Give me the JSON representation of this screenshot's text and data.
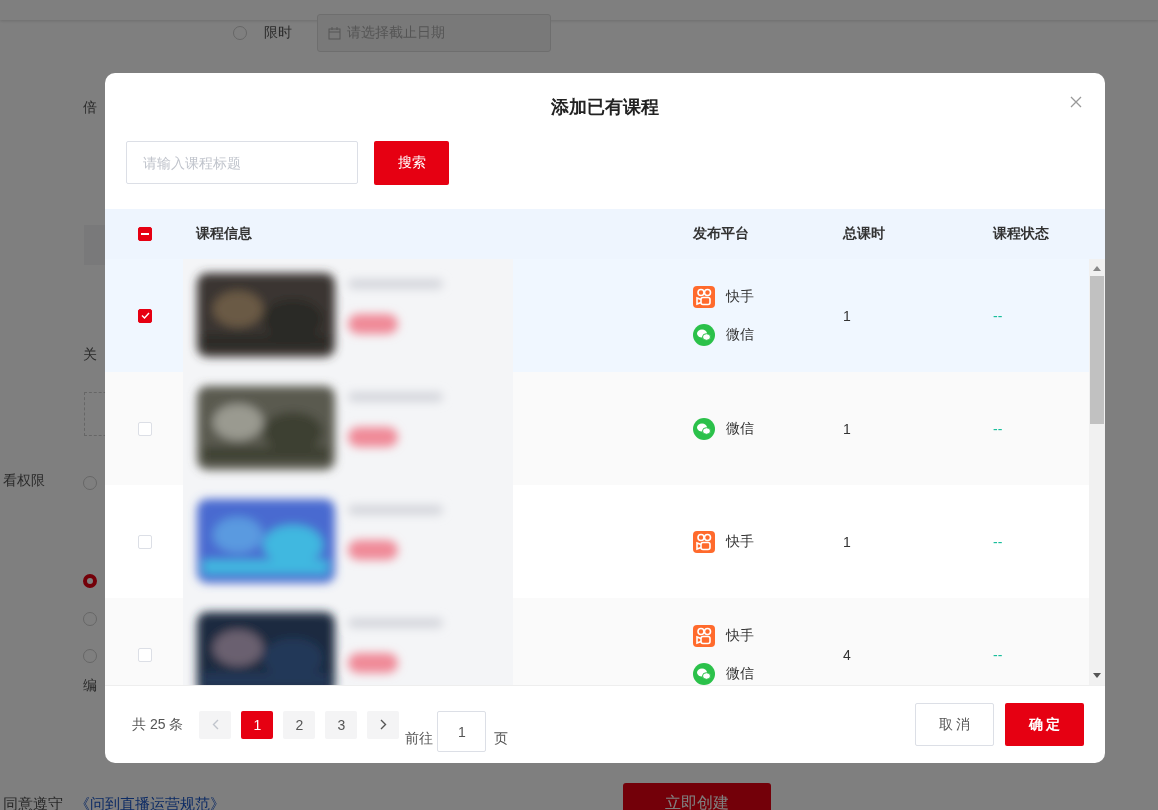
{
  "background": {
    "expiry_radio": {
      "label": "限时",
      "selected": false
    },
    "date_field": {
      "placeholder": "请选择截止日期"
    },
    "labels": [
      "倍",
      "关",
      "看权限"
    ],
    "radios": [
      {
        "selected": false
      },
      {
        "selected": true
      },
      {
        "selected": false
      },
      {
        "selected": false
      }
    ],
    "edit_label": "编",
    "agreement_text": "同意遵守",
    "agreement_link": "《问到直播运营规范》",
    "create_button": "立即创建"
  },
  "dialog": {
    "title": "添加已有课程",
    "search": {
      "placeholder": "请输入课程标题",
      "button": "搜索"
    },
    "table": {
      "select_all": {
        "indeterminate": true
      },
      "columns": [
        "课程信息",
        "发布平台",
        "总课时",
        "课程状态"
      ],
      "rows": [
        {
          "checked": true,
          "course": {
            "kind": "picture"
          },
          "platforms": [
            {
              "kind": "kuaishou",
              "name": "快手"
            },
            {
              "kind": "wechat",
              "name": "微信"
            }
          ],
          "hours": "1",
          "status": "--"
        },
        {
          "checked": false,
          "course": {
            "kind": "picture"
          },
          "platforms": [
            {
              "kind": "wechat",
              "name": "微信"
            }
          ],
          "hours": "1",
          "status": "--"
        },
        {
          "checked": false,
          "course": {
            "kind": "picture"
          },
          "platforms": [
            {
              "kind": "kuaishou",
              "name": "快手"
            }
          ],
          "hours": "1",
          "status": "--"
        },
        {
          "checked": false,
          "course": {
            "kind": "picture"
          },
          "platforms": [
            {
              "kind": "kuaishou",
              "name": "快手"
            },
            {
              "kind": "wechat",
              "name": "微信"
            }
          ],
          "hours": "4",
          "status": "--"
        }
      ]
    },
    "pagination": {
      "total": "共 25 条",
      "prev": {
        "disabled": true
      },
      "pages": [
        {
          "label": "1",
          "selected": true
        },
        {
          "label": "2",
          "selected": false
        },
        {
          "label": "3",
          "selected": false
        }
      ],
      "next": {
        "disabled": false
      },
      "goto_label": "前往",
      "goto_value": "1",
      "page_unit": "页"
    },
    "buttons": {
      "cancel": "取 消",
      "confirm": "确 定"
    }
  }
}
